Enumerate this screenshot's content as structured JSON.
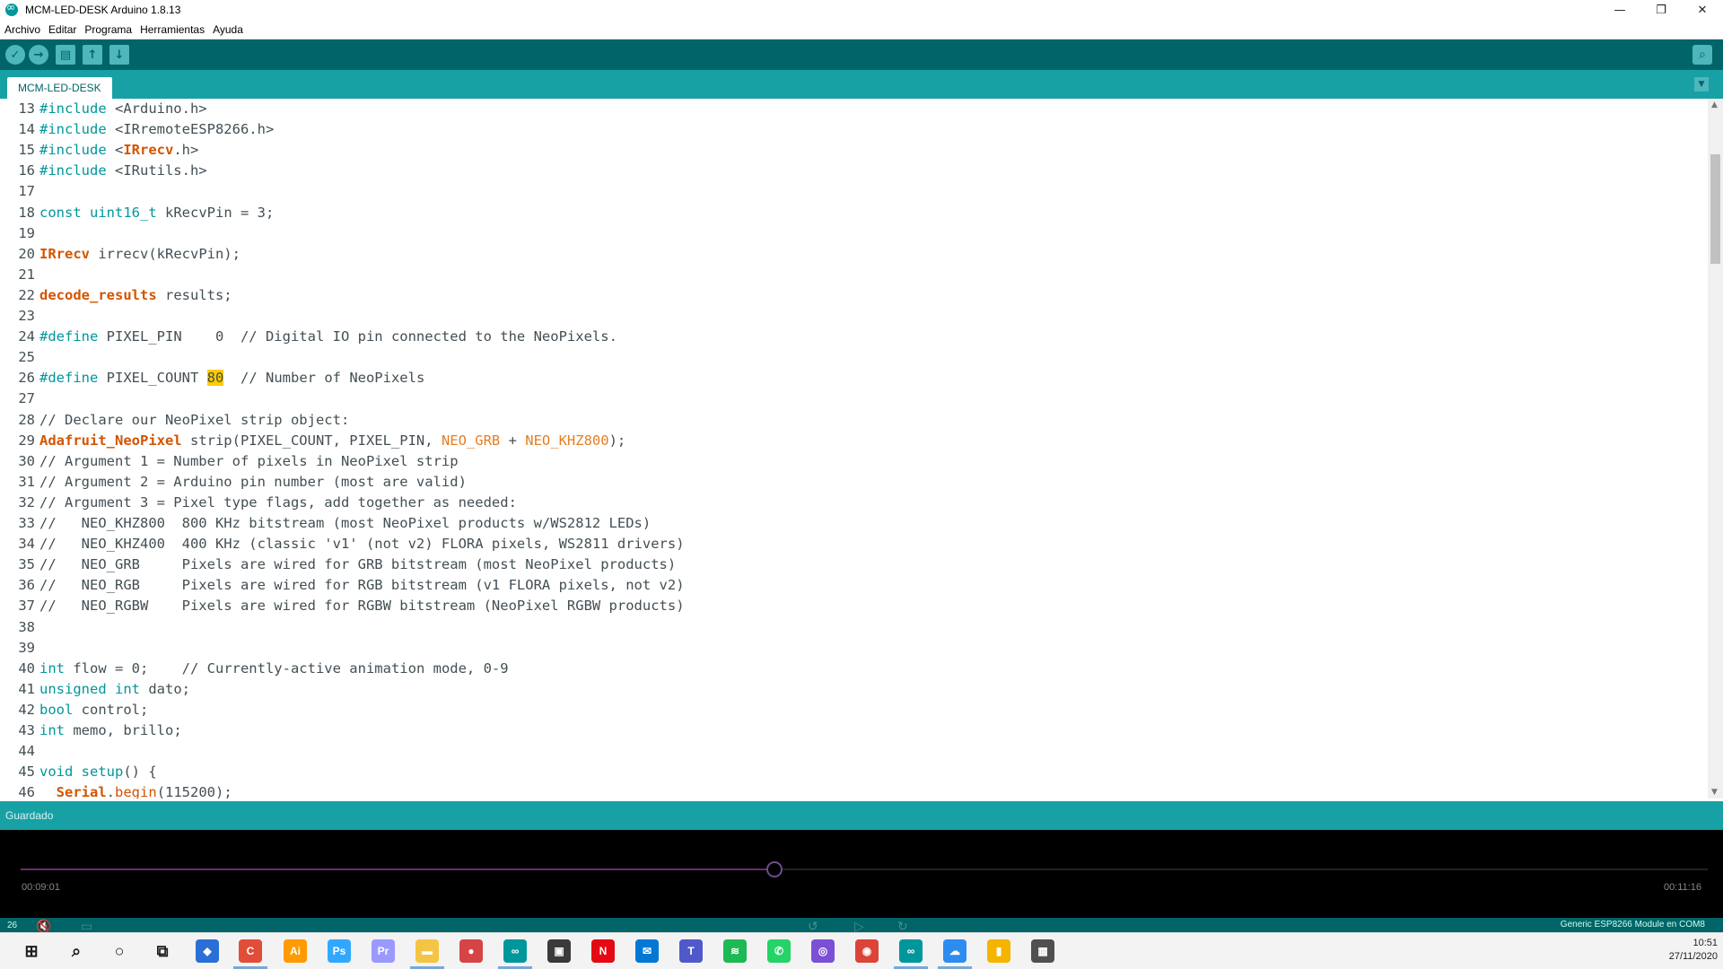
{
  "window": {
    "title": "MCM-LED-DESK Arduino 1.8.13",
    "minimize": "—",
    "restore": "❐",
    "close": "✕"
  },
  "menu": [
    "Archivo",
    "Editar",
    "Programa",
    "Herramientas",
    "Ayuda"
  ],
  "toolbar": {
    "verify": "✓",
    "upload": "→",
    "new": "▤",
    "open": "↑",
    "save": "↓",
    "serial": "⌕"
  },
  "tab": {
    "label": "MCM-LED-DESK",
    "menu": "▼"
  },
  "editor": {
    "lines": [
      {
        "n": "13",
        "t": [
          [
            "kw",
            "#include"
          ],
          [
            "plain",
            " <Arduino.h>"
          ]
        ]
      },
      {
        "n": "14",
        "t": [
          [
            "kw",
            "#include"
          ],
          [
            "plain",
            " <IRremoteESP8266.h>"
          ]
        ]
      },
      {
        "n": "15",
        "t": [
          [
            "kw",
            "#include"
          ],
          [
            "plain",
            " <"
          ],
          [
            "typeb",
            "IRrecv"
          ],
          [
            "plain",
            ".h>"
          ]
        ]
      },
      {
        "n": "16",
        "t": [
          [
            "kw",
            "#include"
          ],
          [
            "plain",
            " <IRutils.h>"
          ]
        ]
      },
      {
        "n": "17",
        "t": []
      },
      {
        "n": "18",
        "t": [
          [
            "kw",
            "const"
          ],
          [
            "plain",
            " "
          ],
          [
            "kw",
            "uint16_t"
          ],
          [
            "plain",
            " kRecvPin = 3;"
          ]
        ]
      },
      {
        "n": "19",
        "t": []
      },
      {
        "n": "20",
        "t": [
          [
            "typeb",
            "IRrecv"
          ],
          [
            "plain",
            " irrecv(kRecvPin);"
          ]
        ]
      },
      {
        "n": "21",
        "t": []
      },
      {
        "n": "22",
        "t": [
          [
            "typeb",
            "decode_results"
          ],
          [
            "plain",
            " results;"
          ]
        ]
      },
      {
        "n": "23",
        "t": []
      },
      {
        "n": "24",
        "t": [
          [
            "kw",
            "#define"
          ],
          [
            "plain",
            " PIXEL_PIN    0  "
          ],
          [
            "cmt",
            "// Digital IO pin connected to the NeoPixels."
          ]
        ]
      },
      {
        "n": "25",
        "t": []
      },
      {
        "n": "26",
        "t": [
          [
            "kw",
            "#define"
          ],
          [
            "plain",
            " PIXEL_COUNT "
          ],
          [
            "hl",
            "80"
          ],
          [
            "plain",
            "  "
          ],
          [
            "cmt",
            "// Number of NeoPixels"
          ]
        ]
      },
      {
        "n": "27",
        "t": []
      },
      {
        "n": "28",
        "t": [
          [
            "cmt",
            "// Declare our NeoPixel strip object:"
          ]
        ]
      },
      {
        "n": "29",
        "t": [
          [
            "typeb",
            "Adafruit_NeoPixel"
          ],
          [
            "plain",
            " strip(PIXEL_COUNT, PIXEL_PIN, "
          ],
          [
            "const",
            "NEO_GRB"
          ],
          [
            "plain",
            " + "
          ],
          [
            "const",
            "NEO_KHZ800"
          ],
          [
            "plain",
            ");"
          ]
        ]
      },
      {
        "n": "30",
        "t": [
          [
            "cmt",
            "// Argument 1 = Number of pixels in NeoPixel strip"
          ]
        ]
      },
      {
        "n": "31",
        "t": [
          [
            "cmt",
            "// Argument 2 = Arduino pin number (most are valid)"
          ]
        ]
      },
      {
        "n": "32",
        "t": [
          [
            "cmt",
            "// Argument 3 = Pixel type flags, add together as needed:"
          ]
        ]
      },
      {
        "n": "33",
        "t": [
          [
            "cmt",
            "//   NEO_KHZ800  800 KHz bitstream (most NeoPixel products w/WS2812 LEDs)"
          ]
        ]
      },
      {
        "n": "34",
        "t": [
          [
            "cmt",
            "//   NEO_KHZ400  400 KHz (classic 'v1' (not v2) FLORA pixels, WS2811 drivers)"
          ]
        ]
      },
      {
        "n": "35",
        "t": [
          [
            "cmt",
            "//   NEO_GRB     Pixels are wired for GRB bitstream (most NeoPixel products)"
          ]
        ]
      },
      {
        "n": "36",
        "t": [
          [
            "cmt",
            "//   NEO_RGB     Pixels are wired for RGB bitstream (v1 FLORA pixels, not v2)"
          ]
        ]
      },
      {
        "n": "37",
        "t": [
          [
            "cmt",
            "//   NEO_RGBW    Pixels are wired for RGBW bitstream (NeoPixel RGBW products)"
          ]
        ]
      },
      {
        "n": "38",
        "t": []
      },
      {
        "n": "39",
        "t": []
      },
      {
        "n": "40",
        "t": [
          [
            "kw",
            "int"
          ],
          [
            "plain",
            " flow = 0;    "
          ],
          [
            "cmt",
            "// Currently-active animation mode, 0-9"
          ]
        ]
      },
      {
        "n": "41",
        "t": [
          [
            "kw",
            "unsigned"
          ],
          [
            "plain",
            " "
          ],
          [
            "kw",
            "int"
          ],
          [
            "plain",
            " dato;"
          ]
        ]
      },
      {
        "n": "42",
        "t": [
          [
            "kw",
            "bool"
          ],
          [
            "plain",
            " control;"
          ]
        ]
      },
      {
        "n": "43",
        "t": [
          [
            "kw",
            "int"
          ],
          [
            "plain",
            " memo, brillo;"
          ]
        ]
      },
      {
        "n": "44",
        "t": []
      },
      {
        "n": "45",
        "t": [
          [
            "kw",
            "void"
          ],
          [
            "plain",
            " "
          ],
          [
            "kw",
            "setup"
          ],
          [
            "plain",
            "() {"
          ]
        ]
      },
      {
        "n": "46",
        "t": [
          [
            "plain",
            "  "
          ],
          [
            "typeb",
            "Serial"
          ],
          [
            "plain",
            "."
          ],
          [
            "type",
            "begin"
          ],
          [
            "plain",
            "(115200);"
          ]
        ]
      }
    ]
  },
  "status": {
    "message": "Guardado"
  },
  "player": {
    "elapsed": "00:09:01",
    "total": "00:11:16",
    "progress": 0.447
  },
  "footer": {
    "line_number": "26",
    "board": "Generic ESP8266 Module en COM8"
  },
  "taskbar": {
    "apps": [
      {
        "name": "start-icon",
        "glyph": "⊞",
        "color": "#1b1b1b"
      },
      {
        "name": "search-icon",
        "glyph": "⌕",
        "color": "#1b1b1b"
      },
      {
        "name": "cortana-icon",
        "glyph": "○",
        "color": "#1b1b1b"
      },
      {
        "name": "task-view-icon",
        "glyph": "⧉",
        "color": "#1b1b1b"
      },
      {
        "name": "app-icon-1",
        "glyph": "◆",
        "color": "#2a6fd6"
      },
      {
        "name": "app-icon-2",
        "glyph": "C",
        "color": "#e04e39"
      },
      {
        "name": "illustrator-icon",
        "glyph": "Ai",
        "color": "#ff9a00"
      },
      {
        "name": "photoshop-icon",
        "glyph": "Ps",
        "color": "#31a8ff"
      },
      {
        "name": "premiere-icon",
        "glyph": "Pr",
        "color": "#9999ff"
      },
      {
        "name": "file-explorer-icon",
        "glyph": "▬",
        "color": "#f4c542"
      },
      {
        "name": "app-icon-3",
        "glyph": "●",
        "color": "#d64545"
      },
      {
        "name": "arduino-icon",
        "glyph": "∞",
        "color": "#00979c"
      },
      {
        "name": "store-icon",
        "glyph": "▣",
        "color": "#3a3a3a"
      },
      {
        "name": "netflix-icon",
        "glyph": "N",
        "color": "#e50914"
      },
      {
        "name": "mail-icon",
        "glyph": "✉",
        "color": "#0078d4"
      },
      {
        "name": "teams-icon",
        "glyph": "T",
        "color": "#5059c9"
      },
      {
        "name": "spotify-icon",
        "glyph": "≋",
        "color": "#1db954"
      },
      {
        "name": "whatsapp-icon",
        "glyph": "✆",
        "color": "#25d366"
      },
      {
        "name": "app-icon-4",
        "glyph": "◎",
        "color": "#7b4fd6"
      },
      {
        "name": "chrome-icon",
        "glyph": "◉",
        "color": "#db4437"
      },
      {
        "name": "arduino-icon-2",
        "glyph": "∞",
        "color": "#00979c"
      },
      {
        "name": "app-icon-5",
        "glyph": "☁",
        "color": "#2d8cf0"
      },
      {
        "name": "app-icon-6",
        "glyph": "▮",
        "color": "#f4b400"
      },
      {
        "name": "calculator-icon",
        "glyph": "▦",
        "color": "#505050"
      }
    ],
    "time": "10:51",
    "date": "27/11/2020"
  },
  "colors": {
    "accent": "#00979c",
    "toolbar": "#006468",
    "tabbar": "#17a1a5"
  }
}
